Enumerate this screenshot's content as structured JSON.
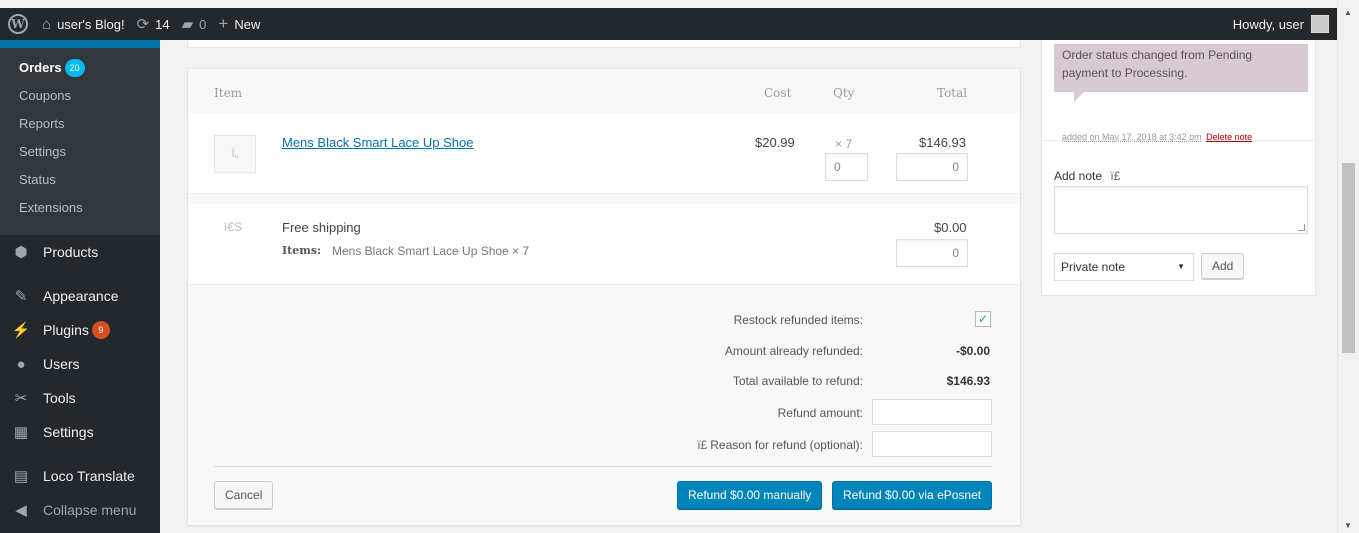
{
  "adminbar": {
    "site_name": "user's Blog!",
    "updates_count": "14",
    "comments_count": "0",
    "new_label": "New",
    "howdy": "Howdy, user"
  },
  "sidebar": {
    "submenu": [
      {
        "label": "Orders",
        "badge": "20"
      },
      {
        "label": "Coupons"
      },
      {
        "label": "Reports"
      },
      {
        "label": "Settings"
      },
      {
        "label": "Status"
      },
      {
        "label": "Extensions"
      }
    ],
    "menu": [
      {
        "label": "Products",
        "icon": "cube-icon"
      },
      {
        "label": "Appearance",
        "icon": "paintbrush-icon"
      },
      {
        "label": "Plugins",
        "badge": "9",
        "icon": "plugin-icon"
      },
      {
        "label": "Users",
        "icon": "users-icon"
      },
      {
        "label": "Tools",
        "icon": "wrench-icon"
      },
      {
        "label": "Settings",
        "icon": "settings-icon"
      },
      {
        "label": "Loco Translate",
        "icon": "translate-icon"
      },
      {
        "label": "Collapse menu",
        "icon": "collapse-icon"
      }
    ]
  },
  "items": {
    "headers": {
      "item": "Item",
      "cost": "Cost",
      "qty": "Qty",
      "total": "Total"
    },
    "product": {
      "name": "Mens Black Smart Lace Up Shoe",
      "cost": "$20.99",
      "qty": "× 7",
      "total": "$146.93",
      "refund_qty": "0",
      "refund_total": "0",
      "thumb_glyph": "Ï„"
    },
    "shipping": {
      "name": "Free shipping",
      "items_label": "Items:",
      "items_value": "Mens Black Smart Lace Up Shoe × 7",
      "total": "$0.00",
      "refund_total": "0",
      "glyph": "ï€S"
    },
    "refund": {
      "restock_label": "Restock refunded items:",
      "restock_checked": true,
      "already_label": "Amount already refunded:",
      "already_value": "-$0.00",
      "available_label": "Total available to refund:",
      "available_value": "$146.93",
      "amount_label": "Refund amount:",
      "reason_glyph": "ï£",
      "reason_label": "Reason for refund (optional):",
      "cancel": "Cancel",
      "manual": "Refund $0.00 manually",
      "via": "Refund $0.00 via ePosnet"
    }
  },
  "notes": {
    "note_text": "Order status changed from Pending payment to Processing.",
    "meta_added": "added on May 17, 2018 at 3:42 pm",
    "delete": "Delete note",
    "add_note_label": "Add note",
    "add_note_glyph": "ï£",
    "note_type": "Private note",
    "add_button": "Add"
  }
}
